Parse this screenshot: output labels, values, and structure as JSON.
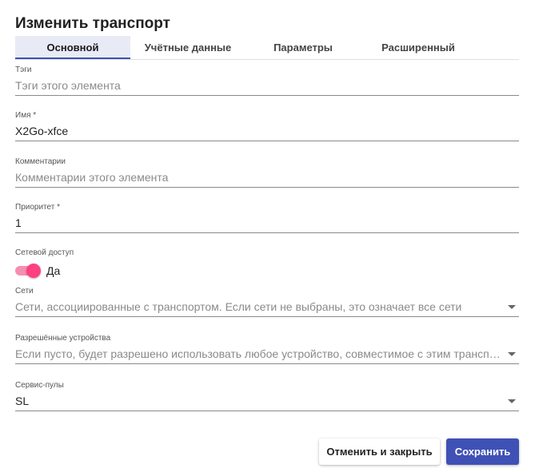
{
  "dialog": {
    "title": "Изменить транспорт"
  },
  "tabs": [
    {
      "label": "Основной",
      "active": true
    },
    {
      "label": "Учётные данные",
      "active": false
    },
    {
      "label": "Параметры",
      "active": false
    },
    {
      "label": "Расширенный",
      "active": false
    }
  ],
  "fields": {
    "tags": {
      "label": "Тэги",
      "value": "",
      "placeholder": "Тэги этого элемента"
    },
    "name": {
      "label": "Имя *",
      "value": "X2Go-xfce"
    },
    "comments": {
      "label": "Комментарии",
      "value": "",
      "placeholder": "Комментарии этого элемента"
    },
    "priority": {
      "label": "Приоритет *",
      "value": "1"
    },
    "network_access": {
      "label": "Сетевой доступ",
      "toggle_label": "Да",
      "enabled": true
    },
    "networks": {
      "label": "Сети",
      "placeholder": "Сети, ассоциированные с транспортом. Если сети не выбраны, это означает все сети"
    },
    "allowed_devices": {
      "label": "Разрешённые устройства",
      "placeholder": "Если пусто, будет разрешено использовать любое устройство, совместимое с этим транспортом"
    },
    "service_pools": {
      "label": "Сервис-пулы",
      "value": "SL"
    }
  },
  "actions": {
    "cancel_label": "Отменить и закрыть",
    "save_label": "Сохранить"
  },
  "colors": {
    "primary": "#3f51b5",
    "toggle_accent": "#ff4081"
  }
}
